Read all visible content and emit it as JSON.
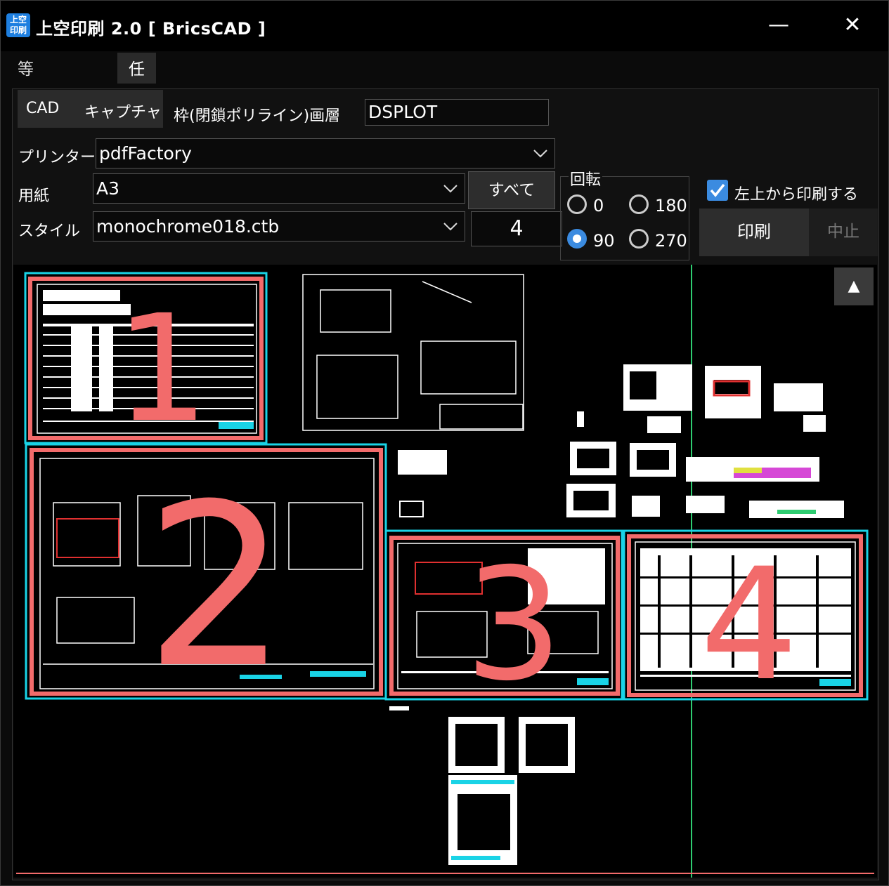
{
  "titlebar": {
    "icon_text": "上空\n印刷",
    "title": "上空印刷 2.0 [ BricsCAD ]",
    "minimize": "—",
    "close": "✕"
  },
  "tabs": [
    "等間隔配置",
    "任意枠配置"
  ],
  "capture": {
    "cad": "CAD",
    "capture": "キャプチャ"
  },
  "layer": {
    "label": "枠(閉鎖ポリライン)画層",
    "value": "DSPLOT"
  },
  "printer": {
    "label": "プリンター",
    "value": "pdfFactory"
  },
  "paper": {
    "label": "用紙",
    "value": "A3"
  },
  "style": {
    "label": "スタイル",
    "value": "monochrome018.ctb"
  },
  "all_button": "すべて",
  "count": "4",
  "rotation": {
    "label": "回転",
    "options": [
      "0",
      "180",
      "90",
      "270"
    ],
    "selected": "90"
  },
  "print_from_top_left": {
    "label": "左上から印刷する",
    "checked": true
  },
  "print_button": "印刷",
  "stop_button": "中止",
  "scroll_up": "▲",
  "frames": [
    "1",
    "2",
    "3",
    "4"
  ],
  "colors": {
    "frame_red": "#f26b6b",
    "frame_cyan": "#19d3e6",
    "accent_blue": "#3b8be0",
    "guide_green": "#2ecc71"
  }
}
